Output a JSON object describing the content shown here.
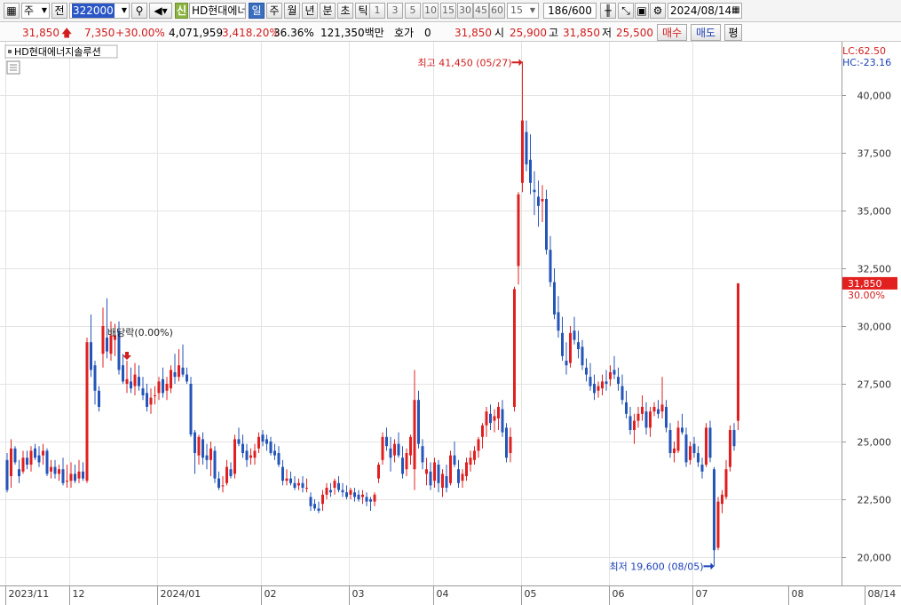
{
  "toolbar": {
    "market": "주",
    "prev": "전",
    "code": "322000",
    "shin": "신",
    "stock_name": "HD현대에너",
    "period_day": "일",
    "period_week": "주",
    "period_month": "월",
    "period_year": "년",
    "period_minute": "분",
    "period_second": "초",
    "period_tick": "틱",
    "intervals": [
      "1",
      "3",
      "5",
      "10",
      "15",
      "30",
      "45",
      "60"
    ],
    "interval_custom": "15",
    "count": "186/600",
    "date": "2024/08/14"
  },
  "quote": {
    "price": "31,850",
    "change": "7,350",
    "change_pct": "+30.00%",
    "volume": "4,071,959",
    "volume_ratio": "3,418.20%",
    "turnover": "36.36%",
    "amount": "121,350백만",
    "hoga_label": "호가",
    "hoga_value": "0",
    "bid_price": "31,850",
    "open_label": "시",
    "open": "25,900",
    "high_label": "고",
    "high": "31,850",
    "low_label": "저",
    "low": "25,500",
    "buy_label": "매수",
    "sell_label": "매도",
    "avg_label": "평"
  },
  "chart_data": {
    "type": "candlestick",
    "title": "HD현대에너지솔루션",
    "lc_label": "LC:62.50",
    "hc_label": "HC:-23.16",
    "y_range": [
      19000,
      42000
    ],
    "y_ticks": [
      20000,
      22500,
      25000,
      27500,
      30000,
      32500,
      35000,
      37500,
      40000
    ],
    "y_tick_labels": [
      "20,000",
      "22,500",
      "25,000",
      "27,500",
      "30,000",
      "32,500",
      "35,000",
      "37,500",
      "40,000"
    ],
    "x_labels": [
      "2023/11",
      "12",
      "2024/01",
      "02",
      "03",
      "04",
      "05",
      "06",
      "07",
      "08",
      "08/14"
    ],
    "x_label_index": [
      0,
      16,
      38,
      64,
      86,
      107,
      129,
      151,
      172,
      196,
      215
    ],
    "current_price_label": "31,850",
    "current_pct_label": "30.00%",
    "max_annotation": "최고 41,450 (05/27)",
    "min_annotation": "최저 19,600 (08/05)",
    "dividend_annotation": "배당락(0.00%)",
    "candles": [
      [
        24200,
        24500,
        22800,
        22900
      ],
      [
        23500,
        25100,
        23000,
        24700
      ],
      [
        24700,
        24800,
        24000,
        24100
      ],
      [
        23800,
        24200,
        23200,
        23500
      ],
      [
        23700,
        24600,
        23600,
        24300
      ],
      [
        24300,
        24600,
        23800,
        24000
      ],
      [
        24000,
        24800,
        23700,
        24600
      ],
      [
        24700,
        24900,
        24200,
        24300
      ],
      [
        24400,
        24800,
        23900,
        24100
      ],
      [
        24400,
        24900,
        24000,
        24600
      ],
      [
        24600,
        24700,
        23500,
        23600
      ],
      [
        23700,
        24200,
        23400,
        23900
      ],
      [
        23900,
        24200,
        23400,
        23600
      ],
      [
        23600,
        24000,
        23300,
        23800
      ],
      [
        23800,
        24300,
        23100,
        23200
      ],
      [
        23300,
        24000,
        23000,
        23300
      ],
      [
        23300,
        24100,
        23000,
        23600
      ],
      [
        23600,
        24000,
        23200,
        23300
      ],
      [
        23400,
        24200,
        23200,
        23700
      ],
      [
        23700,
        24100,
        23300,
        23400
      ],
      [
        23300,
        29500,
        23200,
        29300
      ],
      [
        29300,
        30500,
        27800,
        28100
      ],
      [
        28300,
        28500,
        26600,
        27200
      ],
      [
        27200,
        27400,
        26300,
        26500
      ],
      [
        28800,
        30800,
        28200,
        30000
      ],
      [
        29500,
        31200,
        28600,
        28900
      ],
      [
        28800,
        30200,
        28500,
        29600
      ],
      [
        29400,
        30100,
        28700,
        29600
      ],
      [
        29800,
        30200,
        27900,
        28100
      ],
      [
        28300,
        28800,
        27500,
        27600
      ],
      [
        27500,
        28500,
        27100,
        27700
      ],
      [
        27600,
        28200,
        27100,
        27300
      ],
      [
        27400,
        28400,
        27000,
        27900
      ],
      [
        27800,
        28300,
        27200,
        27400
      ],
      [
        27300,
        27800,
        26800,
        27000
      ],
      [
        27100,
        27500,
        26300,
        26500
      ],
      [
        26600,
        27300,
        26200,
        26900
      ],
      [
        27000,
        27400,
        26600,
        27000
      ],
      [
        27100,
        27800,
        26800,
        27600
      ],
      [
        27700,
        28200,
        26900,
        27100
      ],
      [
        27200,
        27800,
        26800,
        27500
      ],
      [
        27300,
        28300,
        27100,
        28100
      ],
      [
        28000,
        28800,
        27500,
        27800
      ],
      [
        27800,
        29000,
        27600,
        28300
      ],
      [
        28200,
        29200,
        27800,
        27900
      ],
      [
        27900,
        28200,
        27500,
        27600
      ],
      [
        27500,
        27800,
        25200,
        25300
      ],
      [
        25400,
        25500,
        23600,
        24500
      ],
      [
        24400,
        25300,
        24000,
        25200
      ],
      [
        25100,
        25400,
        24000,
        24300
      ],
      [
        24400,
        24900,
        23800,
        24200
      ],
      [
        24200,
        25000,
        23500,
        24700
      ],
      [
        24600,
        24800,
        23200,
        23400
      ],
      [
        23400,
        23700,
        22900,
        23000
      ],
      [
        23100,
        23500,
        22800,
        23100
      ],
      [
        23200,
        24200,
        23100,
        23900
      ],
      [
        23800,
        24100,
        23400,
        23500
      ],
      [
        23600,
        25300,
        23400,
        25100
      ],
      [
        25100,
        25600,
        24800,
        24900
      ],
      [
        24900,
        25300,
        24300,
        24500
      ],
      [
        24600,
        24900,
        23900,
        24200
      ],
      [
        24300,
        24700,
        24000,
        24400
      ],
      [
        24300,
        24900,
        24000,
        24600
      ],
      [
        24700,
        25400,
        24500,
        25200
      ],
      [
        25300,
        25500,
        24800,
        25000
      ],
      [
        25100,
        25300,
        24600,
        24900
      ],
      [
        25000,
        25200,
        24400,
        24500
      ],
      [
        24600,
        24900,
        24200,
        24400
      ],
      [
        24500,
        24800,
        23900,
        24000
      ],
      [
        23900,
        24200,
        23100,
        23300
      ],
      [
        23300,
        23800,
        23100,
        23400
      ],
      [
        23400,
        23700,
        23100,
        23200
      ],
      [
        23200,
        23500,
        22900,
        23000
      ],
      [
        23100,
        23400,
        22900,
        23200
      ],
      [
        23200,
        23500,
        22800,
        23000
      ],
      [
        23000,
        23400,
        22800,
        23000
      ],
      [
        22600,
        22800,
        22000,
        22200
      ],
      [
        22300,
        22500,
        22000,
        22100
      ],
      [
        22100,
        22400,
        21900,
        22000
      ],
      [
        22300,
        22900,
        22000,
        22700
      ],
      [
        22700,
        23200,
        22500,
        23000
      ],
      [
        22900,
        23200,
        22600,
        22800
      ],
      [
        23000,
        23400,
        22700,
        23300
      ],
      [
        23200,
        23500,
        22800,
        22900
      ],
      [
        22900,
        23200,
        22600,
        22800
      ],
      [
        22800,
        23100,
        22500,
        22600
      ],
      [
        22700,
        23000,
        22500,
        22900
      ],
      [
        22800,
        23000,
        22400,
        22600
      ],
      [
        22700,
        22900,
        22400,
        22500
      ],
      [
        22600,
        22900,
        22300,
        22700
      ],
      [
        22600,
        22800,
        22200,
        22400
      ],
      [
        22500,
        22600,
        22000,
        22400
      ],
      [
        22400,
        22800,
        22200,
        22700
      ],
      [
        23400,
        24100,
        23200,
        24000
      ],
      [
        24200,
        25400,
        24000,
        25200
      ],
      [
        25200,
        25600,
        24600,
        24800
      ],
      [
        24700,
        25200,
        23700,
        24300
      ],
      [
        24400,
        25100,
        24100,
        24900
      ],
      [
        24900,
        25400,
        24300,
        24400
      ],
      [
        24300,
        24800,
        23400,
        23600
      ],
      [
        23800,
        24700,
        23500,
        24500
      ],
      [
        24400,
        25300,
        24000,
        25200
      ],
      [
        23800,
        28100,
        22900,
        26800
      ],
      [
        26800,
        27200,
        24700,
        24900
      ],
      [
        24800,
        25100,
        23800,
        24100
      ],
      [
        23600,
        24300,
        23100,
        23800
      ],
      [
        23700,
        24100,
        22900,
        23100
      ],
      [
        23300,
        24300,
        23000,
        24100
      ],
      [
        24000,
        24200,
        22800,
        23200
      ],
      [
        23000,
        23800,
        22600,
        23600
      ],
      [
        23500,
        24000,
        22800,
        23000
      ],
      [
        23200,
        24600,
        23100,
        24400
      ],
      [
        24400,
        25000,
        23900,
        24000
      ],
      [
        23800,
        24200,
        23000,
        23200
      ],
      [
        23300,
        23800,
        23000,
        23600
      ],
      [
        23500,
        24300,
        23300,
        24100
      ],
      [
        24000,
        24600,
        23700,
        24300
      ],
      [
        24200,
        24800,
        24000,
        24600
      ],
      [
        24600,
        25200,
        24300,
        25100
      ],
      [
        25200,
        25800,
        24700,
        25700
      ],
      [
        25700,
        26500,
        25200,
        26300
      ],
      [
        26200,
        26600,
        25500,
        25800
      ],
      [
        25900,
        26400,
        25400,
        26100
      ],
      [
        26000,
        26700,
        25500,
        26500
      ],
      [
        26400,
        26800,
        25200,
        25400
      ],
      [
        25600,
        25800,
        24100,
        24300
      ],
      [
        24500,
        25600,
        24100,
        25200
      ],
      [
        26500,
        31700,
        26300,
        31600
      ],
      [
        32600,
        35800,
        31800,
        35700
      ],
      [
        36200,
        41450,
        35800,
        38900
      ],
      [
        38400,
        38900,
        36700,
        37000
      ],
      [
        37200,
        38300,
        35700,
        36200
      ],
      [
        35900,
        36700,
        34800,
        35800
      ],
      [
        35600,
        36300,
        34300,
        35200
      ],
      [
        35400,
        36100,
        34500,
        35500
      ],
      [
        35500,
        35900,
        33100,
        33300
      ],
      [
        33300,
        33900,
        31700,
        31900
      ],
      [
        31900,
        32500,
        30300,
        30500
      ],
      [
        30600,
        31300,
        29500,
        29800
      ],
      [
        29700,
        30400,
        28500,
        28700
      ],
      [
        28500,
        29300,
        27900,
        28300
      ],
      [
        28400,
        30000,
        28200,
        29700
      ],
      [
        29800,
        30400,
        29200,
        29400
      ],
      [
        29300,
        29800,
        28600,
        29000
      ],
      [
        29100,
        29400,
        28100,
        28300
      ],
      [
        28200,
        28600,
        27600,
        27900
      ],
      [
        27800,
        28400,
        27200,
        27400
      ],
      [
        27500,
        27900,
        26800,
        27100
      ],
      [
        27200,
        27600,
        26900,
        27400
      ],
      [
        27300,
        27900,
        27000,
        27600
      ],
      [
        27600,
        28100,
        27200,
        27500
      ],
      [
        27700,
        28300,
        27400,
        28000
      ],
      [
        28100,
        28700,
        27700,
        27900
      ],
      [
        27800,
        28200,
        27200,
        27500
      ],
      [
        27400,
        27900,
        26600,
        26800
      ],
      [
        26700,
        27200,
        26000,
        26200
      ],
      [
        26100,
        26500,
        25300,
        25500
      ],
      [
        25500,
        26200,
        24900,
        25900
      ],
      [
        25900,
        26500,
        25600,
        26200
      ],
      [
        26200,
        27000,
        25900,
        26500
      ],
      [
        26300,
        26700,
        25300,
        25600
      ],
      [
        25600,
        26500,
        25200,
        26300
      ],
      [
        26300,
        26700,
        26100,
        26500
      ],
      [
        26400,
        26800,
        26000,
        26200
      ],
      [
        26300,
        27800,
        26000,
        26600
      ],
      [
        26500,
        26800,
        25400,
        25600
      ],
      [
        25500,
        25800,
        24300,
        24500
      ],
      [
        24500,
        25000,
        24100,
        24700
      ],
      [
        24600,
        25900,
        24500,
        25600
      ],
      [
        25600,
        26200,
        25300,
        25400
      ],
      [
        25300,
        25600,
        23900,
        24100
      ],
      [
        24200,
        25000,
        24000,
        24800
      ],
      [
        24900,
        25200,
        24300,
        24500
      ],
      [
        24500,
        24800,
        23900,
        24100
      ],
      [
        24000,
        24300,
        23400,
        23700
      ],
      [
        24000,
        25800,
        23900,
        25600
      ],
      [
        25600,
        25900,
        24100,
        24300
      ],
      [
        23800,
        23900,
        19600,
        20300
      ],
      [
        20400,
        22600,
        20300,
        22400
      ],
      [
        22300,
        22900,
        21900,
        22700
      ],
      [
        22600,
        24200,
        22500,
        23800
      ],
      [
        23900,
        25700,
        23700,
        25500
      ],
      [
        25500,
        25800,
        24600,
        24800
      ],
      [
        25900,
        31850,
        25500,
        31850
      ]
    ]
  }
}
